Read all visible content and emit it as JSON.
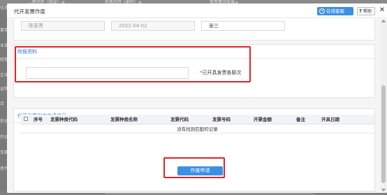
{
  "background": {
    "tabs": [
      "...票代开（协议）≡",
      "开票代开（地区）≡",
      "带票情况监录≡"
    ],
    "side_labels": [
      "信息",
      "事项",
      "业调",
      "经营地",
      "企业",
      "证明",
      "合",
      "形式",
      "开式",
      "车辆",
      "票代"
    ]
  },
  "dialog": {
    "title": "代开发票作废",
    "service_btn": "在线客服",
    "service_icon": "headset-icon",
    "help_btn": "帮助",
    "close": "✕"
  },
  "top_fields": {
    "operator": "陈家秀",
    "date": "2022-04-02",
    "name": "张三"
  },
  "attachments": {
    "title": "附报资料",
    "file_value": "",
    "required_mark": "*",
    "required_label": "已开具发票各联次"
  },
  "invoice_panel": {
    "title": "代开发票作废申请信息",
    "columns": [
      "序号",
      "发票种类代码",
      "发票种类名称",
      "发票代码",
      "发票号码",
      "开票金额",
      "备注",
      "开具日期"
    ],
    "empty_text": "没有找到匹配的记录",
    "apply_btn": "作废申请"
  },
  "colors": {
    "accent": "#3d8fe3",
    "highlight": "#e52222",
    "section_title": "#2a7dd6"
  }
}
